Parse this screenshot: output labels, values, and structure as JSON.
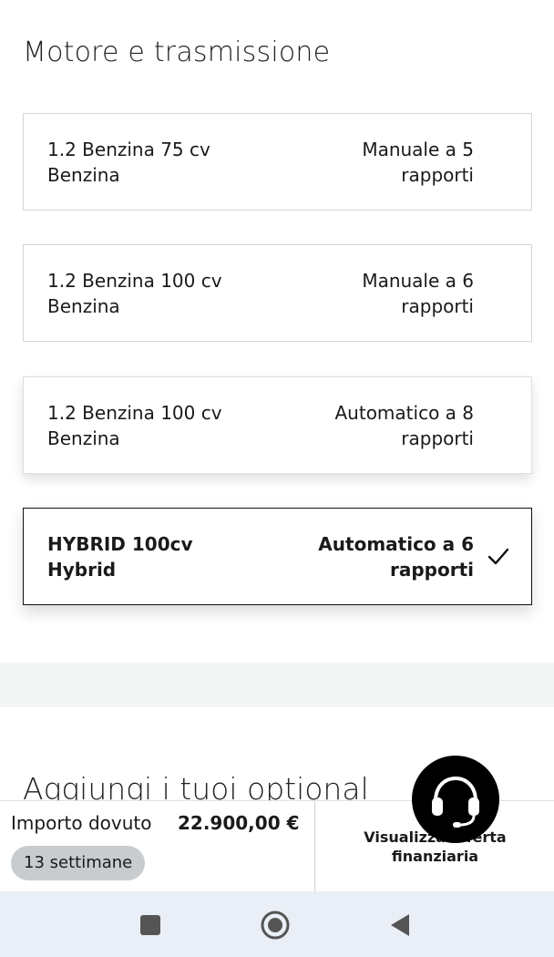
{
  "section_title": "Motore e trasmissione",
  "engines": [
    {
      "name": "1.2 Benzina 75 cv",
      "fuel": "Benzina",
      "transmission_line1": "Manuale a 5",
      "transmission_line2": "rapporti",
      "selected": false
    },
    {
      "name": "1.2 Benzina 100 cv",
      "fuel": "Benzina",
      "transmission_line1": "Manuale a 6",
      "transmission_line2": "rapporti",
      "selected": false
    },
    {
      "name": "1.2 Benzina 100 cv",
      "fuel": "Benzina",
      "transmission_line1": "Automatico a 8",
      "transmission_line2": "rapporti",
      "selected": false
    },
    {
      "name": "HYBRID 100cv",
      "fuel": "Hybrid",
      "transmission_line1": "Automatico a 6",
      "transmission_line2": "rapporti",
      "selected": true
    }
  ],
  "optional_title": "Aggiungi i tuoi optional",
  "bottom_bar": {
    "amount_label": "Importo dovuto",
    "amount_value": "22.900,00 €",
    "weeks_badge": "13 settimane",
    "offer_line1": "Visualizza offerta",
    "offer_line2": "finanziaria"
  },
  "icons": {
    "selected": "check-icon",
    "support": "headset-icon",
    "nav_recents": "square-icon",
    "nav_home": "circle-icon",
    "nav_back": "triangle-back-icon"
  }
}
